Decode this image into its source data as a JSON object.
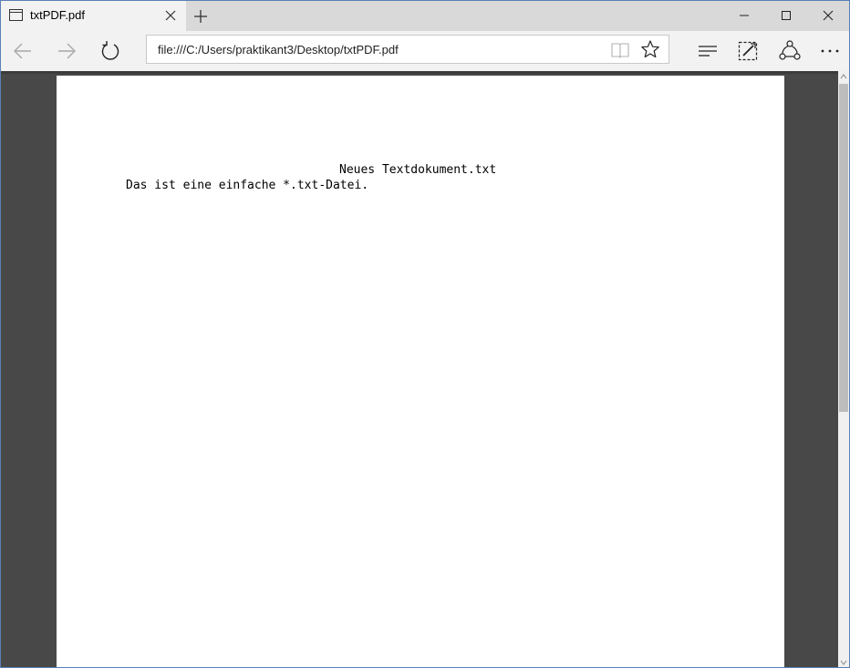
{
  "tab": {
    "title": "txtPDF.pdf",
    "icon": "page-icon"
  },
  "window_controls": [
    "minimize-icon",
    "maximize-icon",
    "close-icon"
  ],
  "nav": {
    "back_icon": "arrow-left-icon",
    "forward_icon": "arrow-right-icon",
    "refresh_icon": "refresh-icon",
    "address": "file:///C:/Users/praktikant3/Desktop/txtPDF.pdf",
    "reading_view_icon": "book-icon",
    "favorite_icon": "star-icon",
    "hub_icon": "hub-icon",
    "note_icon": "web-note-icon",
    "share_icon": "share-icon",
    "more_icon": "more-icon"
  },
  "document": {
    "heading": "Neues Textdokument.txt",
    "lines": [
      "Das ist eine einfache *.txt-Datei."
    ]
  },
  "colors": {
    "titlebar": "#d9d9d9",
    "toolbar": "#f2f2f2",
    "viewer_bg": "#484848",
    "page": "#ffffff"
  }
}
